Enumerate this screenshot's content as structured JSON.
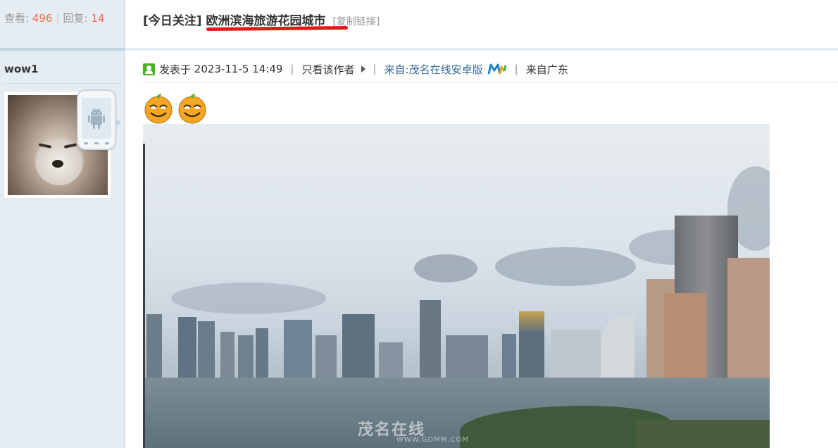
{
  "stats": {
    "views_label": "查看:",
    "views": "496",
    "replies_label": "回复:",
    "replies": "14",
    "separator": "|"
  },
  "thread": {
    "tag": "[今日关注]",
    "title": "欧洲滨海旅游花园城市",
    "copy_link": "[复制链接]"
  },
  "author": {
    "name": "wow1",
    "device_icon": "android-phone-icon"
  },
  "post_meta": {
    "posted_label": "发表于",
    "posted_time": "2023-11-5 14:49",
    "only_author": "只看该作者",
    "source": "来自:茂名在线安卓版",
    "location": "来自广东",
    "separator": "|"
  },
  "emojis": [
    "laughing-orange-emoji",
    "laughing-orange-emoji"
  ],
  "photo": {
    "description_icon": "city-skyline-photo",
    "watermark": "茂名在线",
    "watermark_sub": "WWW.GDMM.COM"
  },
  "colors": {
    "sidebar_bg": "#e5edf2",
    "count_red": "#f26c4f",
    "link_blue": "#336699",
    "online_green": "#4caf22",
    "underline_red": "#e01a1a"
  }
}
